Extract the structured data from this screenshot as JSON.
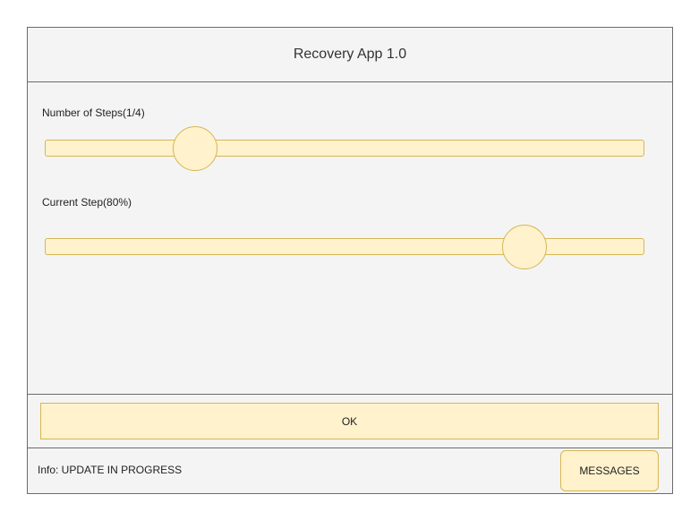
{
  "window": {
    "title": "Recovery App 1.0"
  },
  "steps_slider": {
    "label": "Number of Steps(1/4)",
    "value_fraction": 0.25
  },
  "current_step_slider": {
    "label": "Current Step(80%)",
    "value_fraction": 0.8
  },
  "ok_button": {
    "label": "OK"
  },
  "footer": {
    "info_text": "Info: UPDATE IN PROGRESS",
    "messages_label": "MESSAGES"
  },
  "colors": {
    "control_fill": "#fff2cc",
    "control_border": "#d6b656",
    "panel_background": "#f4f4f4",
    "frame_border": "#6b6b6b"
  }
}
